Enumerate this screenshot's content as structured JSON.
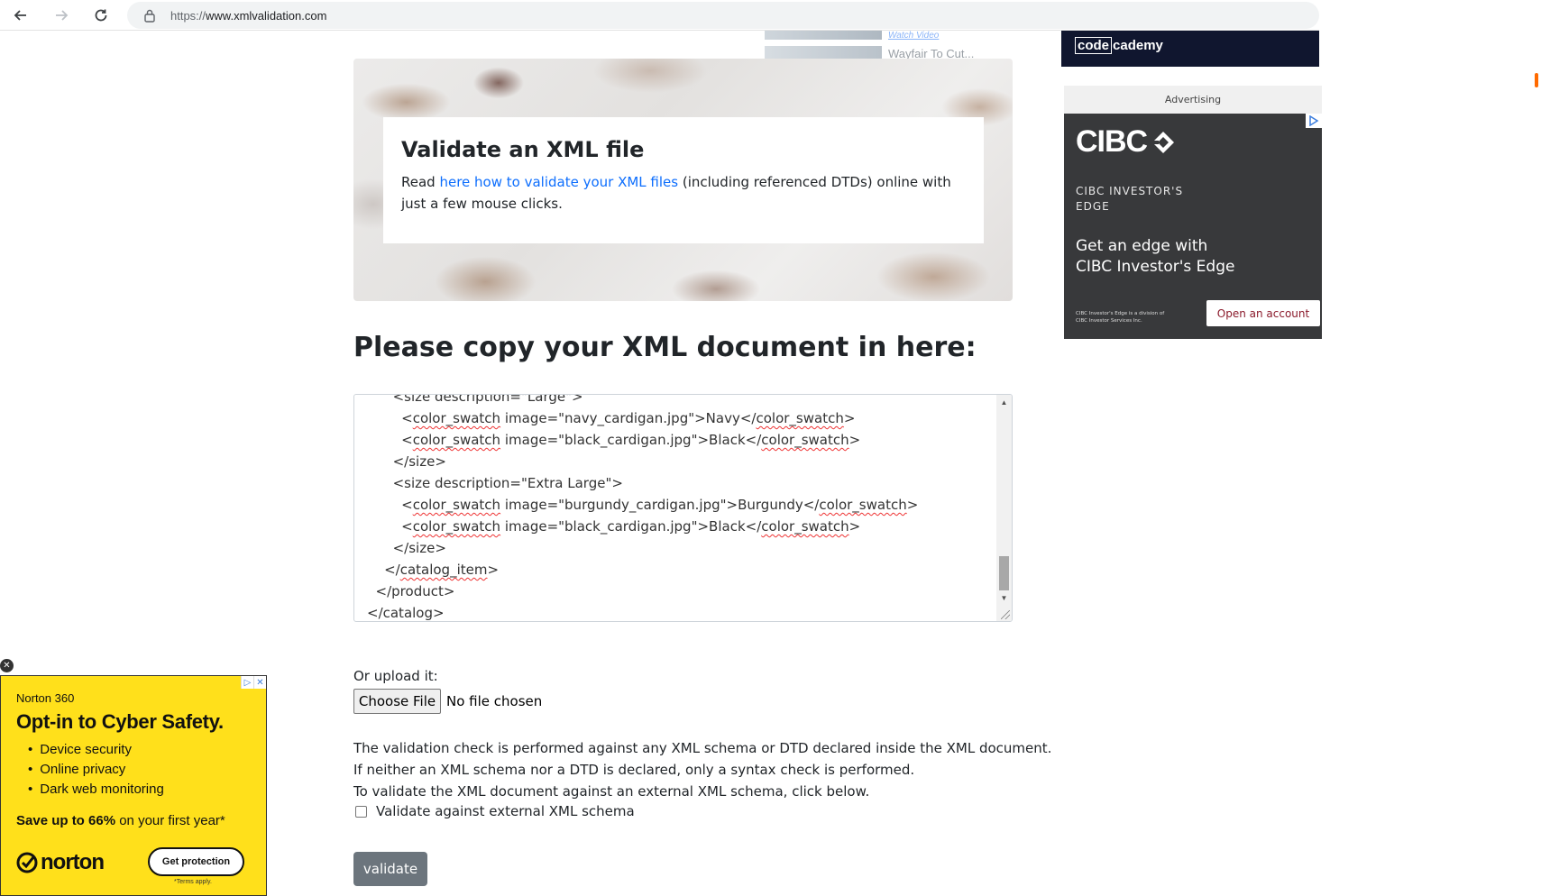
{
  "browser": {
    "url_scheme": "https://",
    "url_host": "www.xmlvalidation.com"
  },
  "top_ad": {
    "link1": "Watch Video",
    "link2": "Wayfair To Cut..."
  },
  "codecademy_ad": {
    "logo_boxed": "code",
    "logo_rest": "cademy"
  },
  "banner": {
    "title": "Validate an XML file",
    "text_before": "Read ",
    "link_text": "here how to validate your XML files",
    "text_after": " (including referenced DTDs) online with just a few mouse clicks."
  },
  "main": {
    "heading": "Please copy your XML document in here:"
  },
  "xml_editor": {
    "lines": [
      "      <size description=\"Large\">",
      "        <color_swatch image=\"navy_cardigan.jpg\">Navy</color_swatch>",
      "        <color_swatch image=\"black_cardigan.jpg\">Black</color_swatch>",
      "      </size>",
      "      <size description=\"Extra Large\">",
      "        <color_swatch image=\"burgundy_cardigan.jpg\">Burgundy</color_swatch>",
      "        <color_swatch image=\"black_cardigan.jpg\">Black</color_swatch>",
      "      </size>",
      "    </catalog_item>",
      "  </product>",
      "</catalog>"
    ]
  },
  "upload": {
    "label": "Or upload it:",
    "button": "Choose File",
    "status": "No file chosen"
  },
  "info": {
    "line1": "The validation check is performed against any XML schema or DTD declared inside the XML document.",
    "line2": "If neither an XML schema nor a DTD is declared, only a syntax check is performed.",
    "line3": "To validate the XML document against an external XML schema, click below.",
    "checkbox_label": "Validate against external XML schema"
  },
  "actions": {
    "validate": "validate"
  },
  "cibc_ad": {
    "label": "Advertising",
    "logo": "CIBC",
    "sub1": "CIBC INVESTOR'S",
    "sub2": "EDGE",
    "headline1": "Get an edge with",
    "headline2": "CIBC Investor's Edge",
    "fine1": "CIBC Investor's Edge is a division of",
    "fine2": "CIBC Investor Services Inc.",
    "button": "Open an account"
  },
  "norton_ad": {
    "brand": "Norton 360",
    "headline": "Opt-in to Cyber Safety.",
    "bullets": [
      "Device security",
      "Online privacy",
      "Dark web monitoring"
    ],
    "save_strong": "Save up to 66%",
    "save_rest": " on your first year*",
    "logo": "norton",
    "button": "Get protection",
    "terms": "*Terms apply."
  },
  "colors": {
    "link": "#0d6efd",
    "validate_button": "#6c757d",
    "norton_yellow": "#ffe01b",
    "cibc_bg": "#38393b",
    "cibc_red": "#8b1a2b"
  }
}
